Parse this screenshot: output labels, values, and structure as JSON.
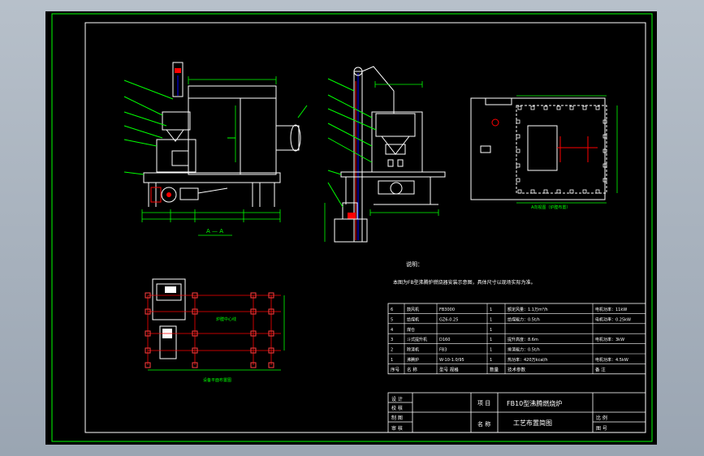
{
  "colors": {
    "background": "#000000",
    "viewport": "#a9b3bf",
    "frame": "#00ff00",
    "machine": "#ffffff",
    "dimension": "#00ff00",
    "grid": "#ff0000",
    "accent_blue": "#0000ff",
    "text": "#ffffff"
  },
  "drawing": {
    "section_label": "A — A",
    "notes_title": "说明：",
    "notes_text": "本图为FB型沸腾炉燃烧器安装示意图，具体尺寸以现场实际为准。",
    "plan_caption": "设备平面布置图",
    "top_view_caption": "A向视图（炉膛布置）",
    "plan_label": "炉膛中心线"
  },
  "parts_table": {
    "headers": [
      "序号",
      "名  称",
      "型号 规格",
      "数量",
      "技术参数",
      "备  注"
    ],
    "rows": [
      {
        "no": "6",
        "name": "鼓风机",
        "spec": "FB3000",
        "qty": "1",
        "param": "额定风量：1.1万m³/h",
        "note": "电机功率：11kW"
      },
      {
        "no": "5",
        "name": "给煤机",
        "spec": "GZ6-0.25",
        "qty": "1",
        "param": "给煤能力：0.5t/h",
        "note": "电机功率：0.25kW"
      },
      {
        "no": "4",
        "name": "煤仓",
        "spec": "",
        "qty": "1",
        "param": "",
        "note": ""
      },
      {
        "no": "3",
        "name": "斗式提升机",
        "spec": "D160",
        "qty": "1",
        "param": "提升高度：8.6m",
        "note": "电机功率：3kW"
      },
      {
        "no": "2",
        "name": "除渣机",
        "spec": "FB3",
        "qty": "1",
        "param": "排渣能力：0.5t/h",
        "note": ""
      },
      {
        "no": "1",
        "name": "沸腾炉",
        "spec": "W-10-1.0/95",
        "qty": "1",
        "param": "热功率：420万kcal/h",
        "note": "电机功率：4.5kW"
      }
    ]
  },
  "title_block": {
    "design_label": "设 计",
    "check_label": "校 核",
    "draw_label": "制 图",
    "approve_label": "审 核",
    "project_label": "项 目",
    "project_name": "FB10型沸腾燃烧炉",
    "name_label": "名 称",
    "drawing_name": "工艺布置简图",
    "scale_label": "比 例",
    "number_label": "图 号"
  }
}
